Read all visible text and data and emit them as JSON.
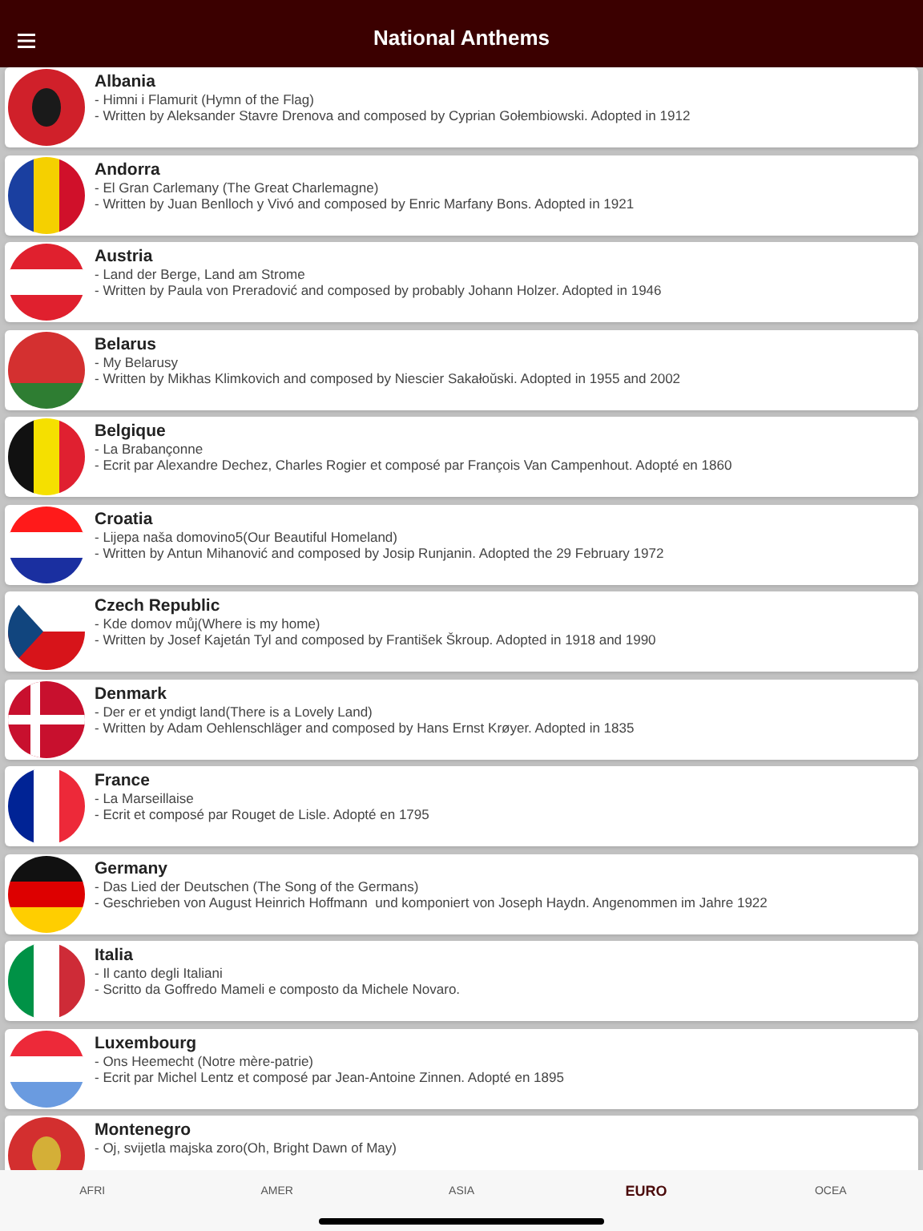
{
  "title": "National Anthems",
  "anthems": [
    {
      "country": "Albania",
      "anthem": "- Himni i Flamurit (Hymn of the Flag)",
      "details": "- Written by Aleksander Stavre Drenova and composed by Cyprian Gołembiowski. Adopted in 1912",
      "kind": "redeagle"
    },
    {
      "country": "Andorra",
      "anthem": "- El Gran Carlemany (The Great Charlemagne)",
      "details": "- Written by Juan Benlloch y Vivó and composed by Enric Marfany Bons. Adopted in 1921",
      "kind": "bluetricolor"
    },
    {
      "country": "Austria",
      "anthem": "- Land der Berge, Land am Strome",
      "details": "- Written by Paula von Preradović and composed by probably Johann Holzer. Adopted in 1946",
      "kind": "redwhitered"
    },
    {
      "country": "Belarus",
      "anthem": "- My Belarusy",
      "details": "- Written by Mikhas Klimkovich and composed by Niescier Sakałoŭski. Adopted in 1955 and 2002",
      "kind": "redgreen"
    },
    {
      "country": "Belgique",
      "anthem": "- La Brabançonne",
      "details": "- Ecrit par Alexandre Dechez, Charles Rogier et composé par François Van Campenhout. Adopté en 1860",
      "kind": "blacktricolor"
    },
    {
      "country": "Croatia",
      "anthem": "- Lijepa naša domovino5(Our Beautiful Homeland)",
      "details": "- Written by Antun Mihanović and composed by Josip Runjanin. Adopted the 29 February 1972",
      "kind": "redwhiteblue"
    },
    {
      "country": "Czech Republic",
      "anthem": "- Kde domov můj(Where is my home)",
      "details": "- Written by Josef Kajetán Tyl and composed by František Škroup. Adopted in 1918 and 1990",
      "kind": "wedge"
    },
    {
      "country": "Denmark",
      "anthem": "- Der er et yndigt land(There is a Lovely Land)",
      "details": "- Written by Adam Oehlenschläger and composed by Hans Ernst Krøyer. Adopted in 1835",
      "kind": "cross"
    },
    {
      "country": "France",
      "anthem": "- La Marseillaise",
      "details": "- Ecrit et composé par Rouget de Lisle. Adopté en 1795",
      "kind": "bluewhitered"
    },
    {
      "country": "Germany",
      "anthem": "- Das Lied der Deutschen (The Song of the Germans)",
      "details": "- Geschrieben von August Heinrich Hoffmann  und komponiert von Joseph Haydn. Angenommen im Jahre 1922",
      "kind": "blackredgold"
    },
    {
      "country": "Italia",
      "anthem": "- Il canto degli Italiani",
      "details": "- Scritto da Goffredo Mameli e composto da Michele Novaro.",
      "kind": "greenwhitered"
    },
    {
      "country": "Luxembourg",
      "anthem": "- Ons Heemecht (Notre mère-patrie)",
      "details": "- Ecrit par Michel Lentz et composé par Jean-Antoine Zinnen. Adopté en 1895",
      "kind": "redwhitesky"
    },
    {
      "country": "Montenegro",
      "anthem": "- Oj, svijetla majska zoro(Oh, Bright Dawn of May)",
      "kind": "goldeagle"
    }
  ],
  "tabs": [
    {
      "label": "AFRI",
      "selected": false
    },
    {
      "label": "AMER",
      "selected": false
    },
    {
      "label": "ASIA",
      "selected": false
    },
    {
      "label": "EURO",
      "selected": true
    },
    {
      "label": "OCEA",
      "selected": false
    }
  ]
}
